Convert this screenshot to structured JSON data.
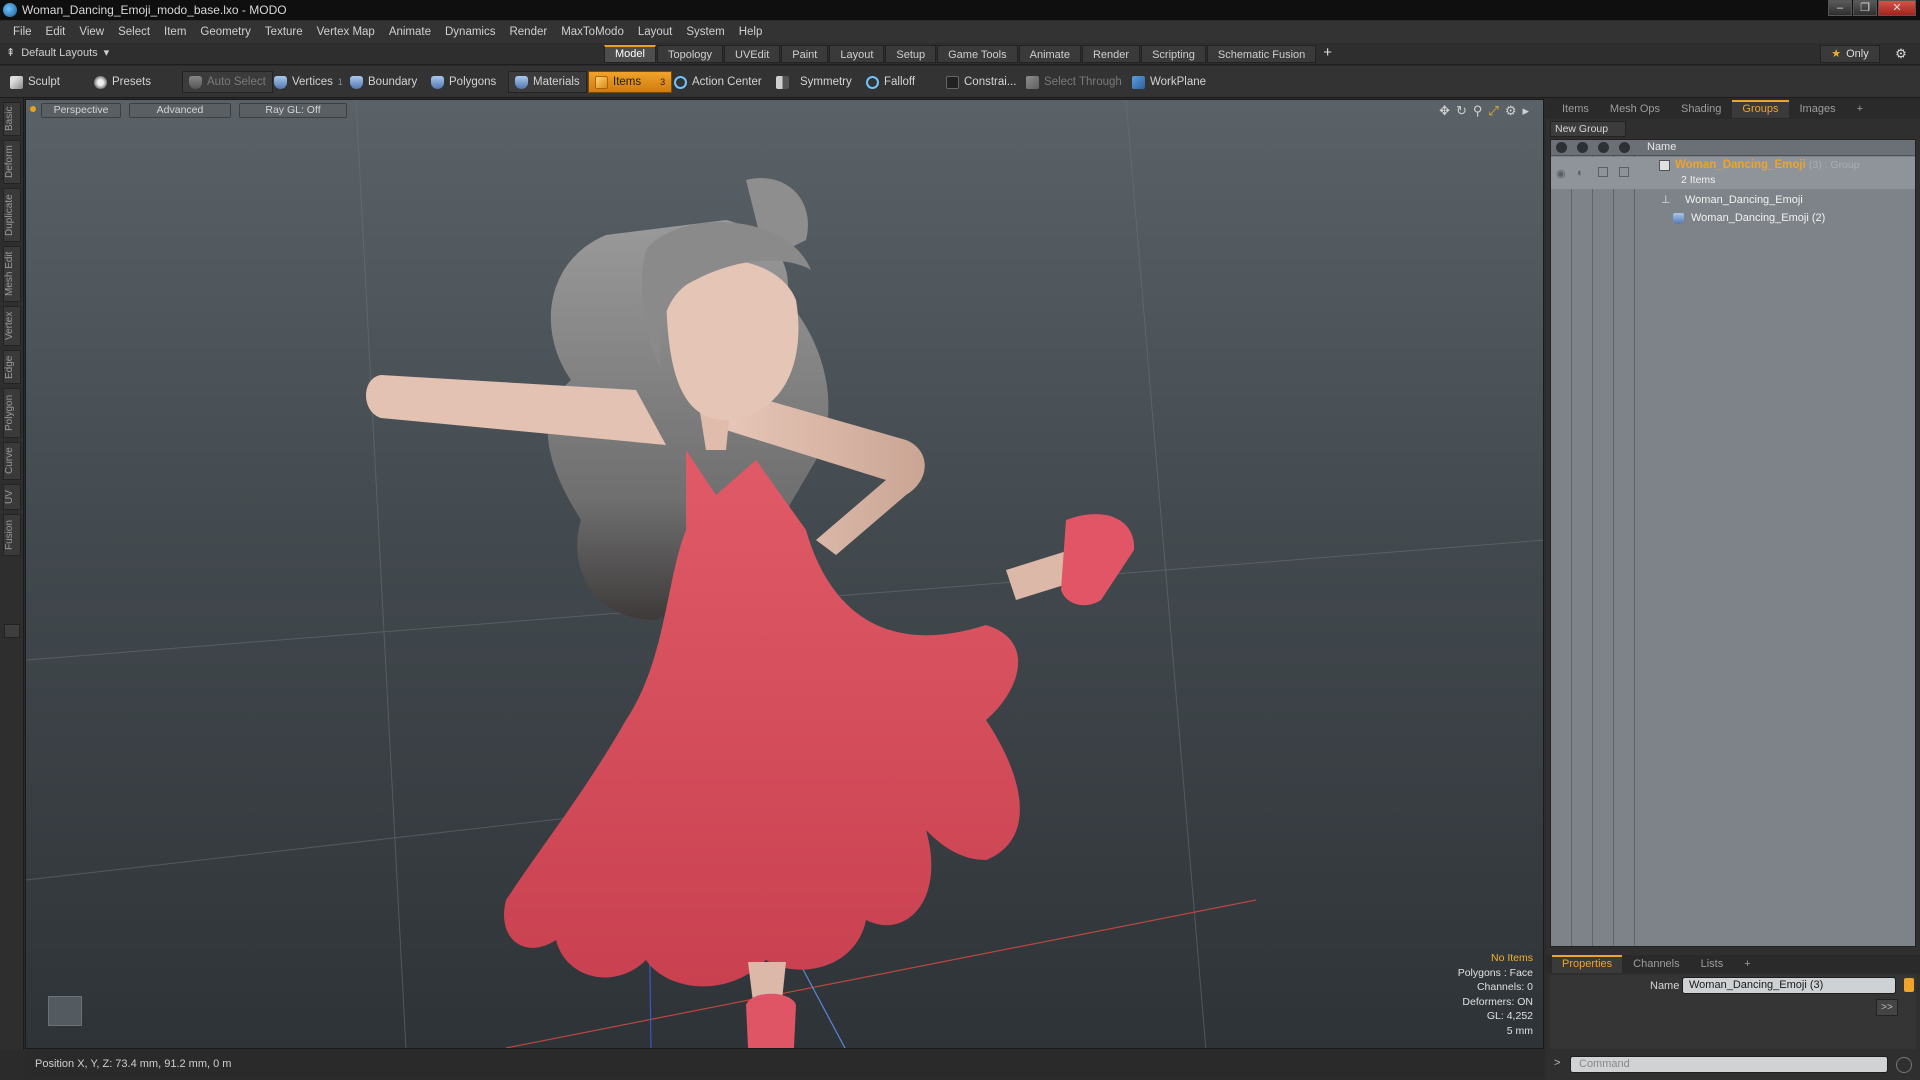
{
  "window": {
    "title": "Woman_Dancing_Emoji_modo_base.lxo - MODO",
    "min_label": "–",
    "max_label": "❐",
    "close_label": "✕"
  },
  "menu": [
    "File",
    "Edit",
    "View",
    "Select",
    "Item",
    "Geometry",
    "Texture",
    "Vertex Map",
    "Animate",
    "Dynamics",
    "Render",
    "MaxToModo",
    "Layout",
    "System",
    "Help"
  ],
  "layout": {
    "selector": "Default Layouts",
    "tabs": [
      "Model",
      "Topology",
      "UVEdit",
      "Paint",
      "Layout",
      "Setup",
      "Game Tools",
      "Animate",
      "Render",
      "Scripting",
      "Schematic Fusion"
    ],
    "active_tab": "Model",
    "add_label": "+",
    "only_label": "Only"
  },
  "toolbar": {
    "sculpt": "Sculpt",
    "presets": "Presets",
    "auto_select": "Auto Select",
    "vertices": "Vertices",
    "vertices_count": "1",
    "boundary": "Boundary",
    "polygons": "Polygons",
    "materials": "Materials",
    "items": "Items",
    "items_count": "3",
    "action_center": "Action Center",
    "symmetry": "Symmetry",
    "falloff": "Falloff",
    "constrain": "Constrai...",
    "select_through": "Select Through",
    "workplane": "WorkPlane"
  },
  "left_tabs": [
    "Basic",
    "Deform",
    "Duplicate",
    "Mesh Edit",
    "Vertex",
    "Edge",
    "Polygon",
    "Curve",
    "UV",
    "Fusion"
  ],
  "viewport": {
    "perspective": "Perspective",
    "advanced": "Advanced",
    "raygl": "Ray GL: Off",
    "stats": {
      "no_items": "No Items",
      "polygons": "Polygons : Face",
      "channels": "Channels: 0",
      "deformers": "Deformers: ON",
      "gl": "GL: 4,252",
      "scale": "5 mm"
    },
    "colors": {
      "dress": "#e0505f",
      "skin": "#e2bfae",
      "hair": "#8f8f8f"
    }
  },
  "status": {
    "position": "Position X, Y, Z:  73.4 mm, 91.2 mm, 0 m"
  },
  "right_panel": {
    "tabs": [
      "Items",
      "Mesh Ops",
      "Shading",
      "Groups",
      "Images"
    ],
    "active_tab": "Groups",
    "add_label": "+",
    "new_group": "New Group",
    "name_header": "Name",
    "group": {
      "name": "Woman_Dancing_Emoji",
      "suffix": "(3) : Group",
      "count": "2 Items"
    },
    "children": [
      "Woman_Dancing_Emoji",
      "Woman_Dancing_Emoji (2)"
    ]
  },
  "properties": {
    "tabs": [
      "Properties",
      "Channels",
      "Lists"
    ],
    "active_tab": "Properties",
    "add_label": "+",
    "name_label": "Name",
    "name_value": "Woman_Dancing_Emoji (3)",
    "expand_label": ">>",
    "command_placeholder": "Command"
  }
}
